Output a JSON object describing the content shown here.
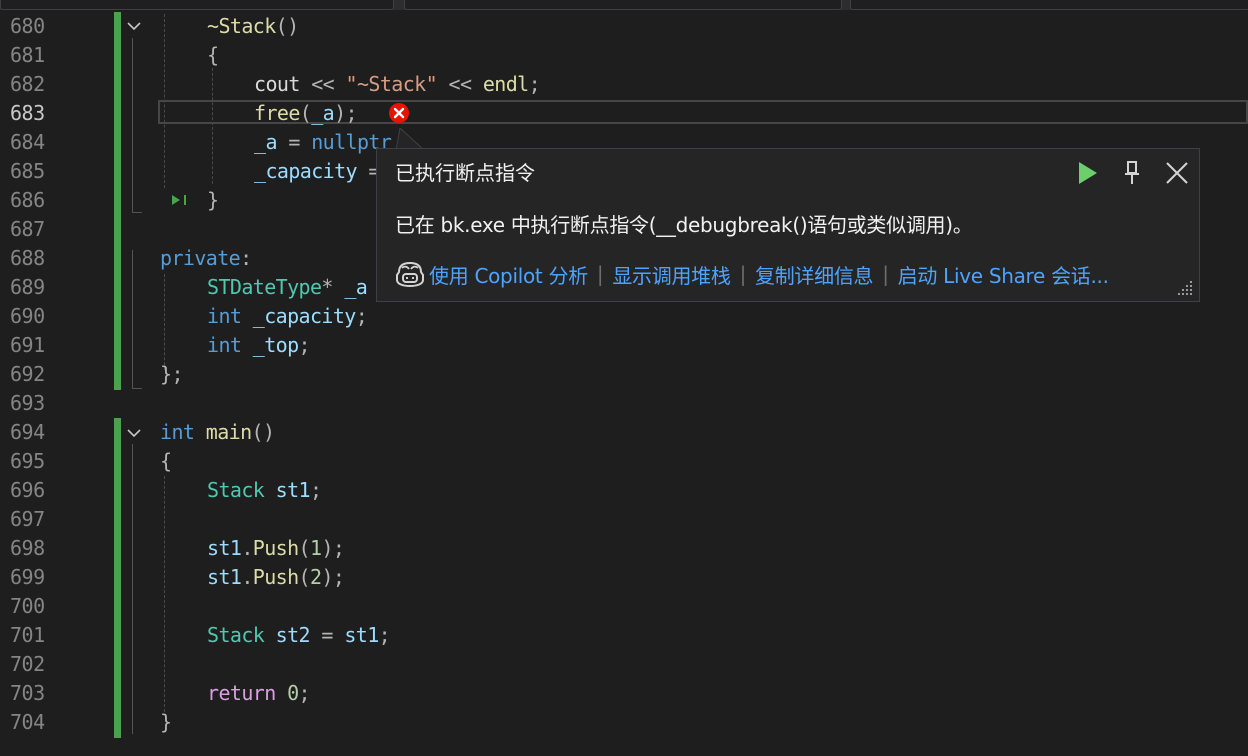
{
  "line_numbers": [
    "680",
    "681",
    "682",
    "683",
    "684",
    "685",
    "686",
    "687",
    "688",
    "689",
    "690",
    "691",
    "692",
    "693",
    "694",
    "695",
    "696",
    "697",
    "698",
    "699",
    "700",
    "701",
    "702",
    "703",
    "704"
  ],
  "current_line": "683",
  "code": {
    "l680": {
      "tilde": "~",
      "name": "Stack",
      "parens": "()"
    },
    "l681": {
      "brace": "{"
    },
    "l682": {
      "cout": "cout",
      "op1": " << ",
      "str": "\"~Stack\"",
      "op2": " << ",
      "endl": "endl",
      "semi": ";"
    },
    "l683": {
      "fn": "free",
      "open": "(",
      "arg": "_a",
      "close": ");"
    },
    "l684": {
      "var": "_a",
      "eq": " = ",
      "kw": "nullptr"
    },
    "l685": {
      "var": "_capacity",
      "rest": " ="
    },
    "l686": {
      "brace": "}"
    },
    "l688": {
      "kw": "private",
      "colon": ":"
    },
    "l689": {
      "type": "STDateType",
      "star": "* ",
      "var": "_a"
    },
    "l690": {
      "kw": "int",
      "var": " _capacity",
      "semi": ";"
    },
    "l691": {
      "kw": "int",
      "var": " _top",
      "semi": ";"
    },
    "l692": {
      "text": "};"
    },
    "l694": {
      "kw": "int",
      "fn": " main",
      "parens": "()"
    },
    "l695": {
      "brace": "{"
    },
    "l696": {
      "type": "Stack",
      "var": " st1",
      "semi": ";"
    },
    "l698": {
      "var": "st1",
      "dot": ".",
      "fn": "Push",
      "open": "(",
      "num": "1",
      "close": ");"
    },
    "l699": {
      "var": "st1",
      "dot": ".",
      "fn": "Push",
      "open": "(",
      "num": "2",
      "close": ");"
    },
    "l701": {
      "type": "Stack",
      "var": " st2",
      "eq": " = ",
      "var2": "st1",
      "semi": ";"
    },
    "l703": {
      "kw": "return",
      "num": " 0",
      "semi": ";"
    },
    "l704": {
      "brace": "}"
    }
  },
  "popup": {
    "title": "已执行断点指令",
    "message": "已在 bk.exe 中执行断点指令(__debugbreak()语句或类似调用)。",
    "links": [
      "使用 Copilot 分析",
      "显示调用堆栈",
      "复制详细信息",
      "启动 Live Share 会话..."
    ],
    "icons": {
      "continue": "play-icon",
      "pin": "pin-icon",
      "close": "close-icon",
      "copilot": "copilot-icon",
      "resize": "resize-grip-icon"
    }
  },
  "colors": {
    "background": "#1e1e1e",
    "change_bar": "#4aa34a",
    "keyword": "#569cd6",
    "type": "#4ec9b0",
    "function": "#dcdcaa",
    "string": "#d69d85",
    "link": "#4da3ff",
    "error": "#e51400"
  }
}
